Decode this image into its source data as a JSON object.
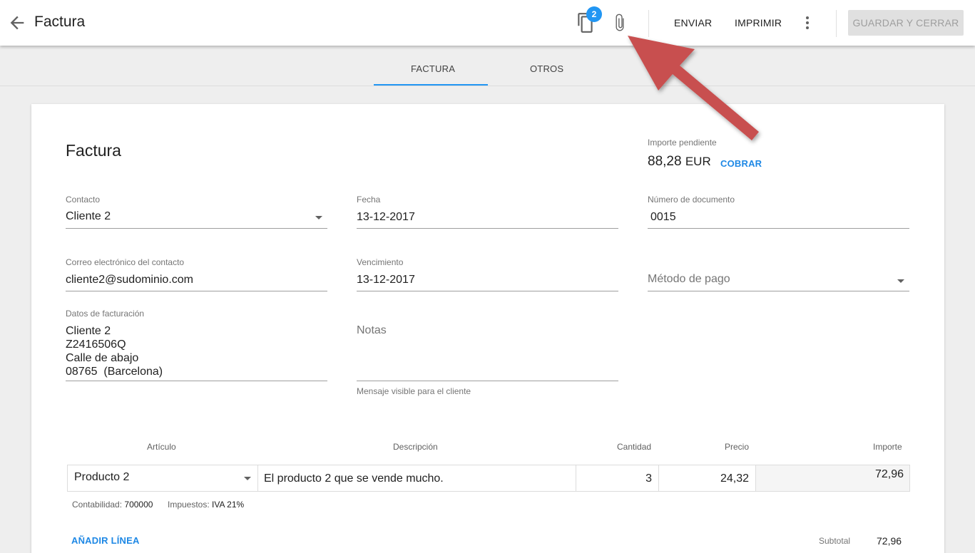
{
  "header": {
    "title": "Factura",
    "badge_count": "2",
    "send_label": "ENVIAR",
    "print_label": "IMPRIMIR",
    "save_close_label": "GUARDAR Y CERRAR"
  },
  "tabs": [
    {
      "label": "FACTURA",
      "active": true
    },
    {
      "label": "OTROS",
      "active": false
    }
  ],
  "form": {
    "title": "Factura",
    "pending": {
      "label": "Importe pendiente",
      "amount": "88,28",
      "currency": "EUR",
      "action": "COBRAR"
    },
    "contact": {
      "label": "Contacto",
      "value": "Cliente 2"
    },
    "date": {
      "label": "Fecha",
      "value": "13-12-2017"
    },
    "doc_number": {
      "label": "Número de documento",
      "value": "0015"
    },
    "email": {
      "label": "Correo electrónico del contacto",
      "value": "cliente2@sudominio.com"
    },
    "due": {
      "label": "Vencimiento",
      "value": "13-12-2017"
    },
    "payment_method": {
      "placeholder": "Método de pago"
    },
    "billing": {
      "label": "Datos de facturación",
      "value": "Cliente 2\nZ2416506Q\nCalle de abajo\n08765  (Barcelona)"
    },
    "notes": {
      "placeholder": "Notas",
      "helper": "Mensaje visible para el cliente"
    }
  },
  "table": {
    "headers": {
      "item": "Artículo",
      "description": "Descripción",
      "quantity": "Cantidad",
      "price": "Precio",
      "amount": "Importe"
    },
    "rows": [
      {
        "item": "Producto 2",
        "description": "El producto 2 que se vende mucho.",
        "quantity": "3",
        "price": "24,32",
        "amount": "72,96",
        "accounting_label": "Contabilidad:",
        "accounting": "700000",
        "tax_label": "Impuestos:",
        "tax": "IVA 21%"
      }
    ],
    "add_line": "AÑADIR LÍNEA",
    "subtotal_label": "Subtotal",
    "subtotal": "72,96"
  },
  "colors": {
    "accent": "#2196f3",
    "arrow": "#c85050"
  }
}
